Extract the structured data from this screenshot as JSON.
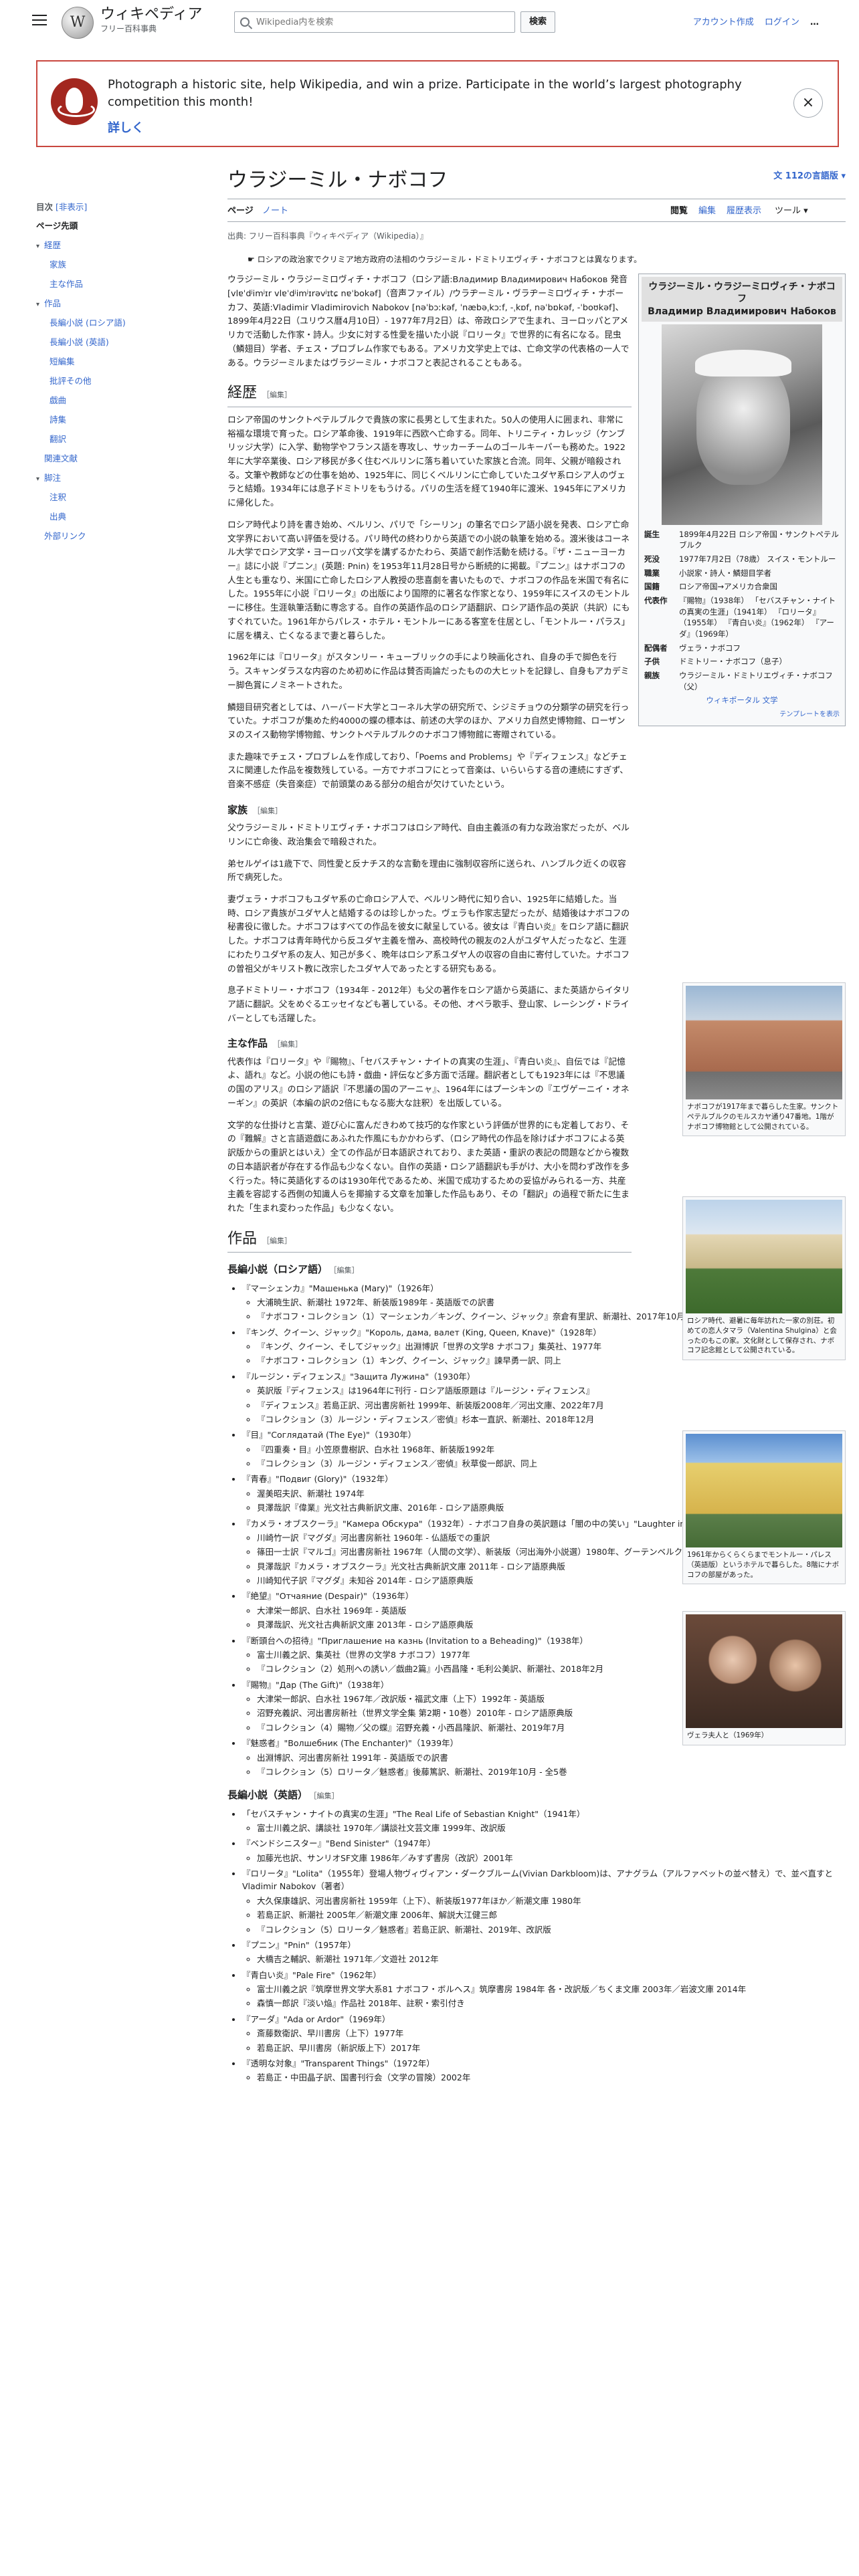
{
  "header": {
    "logo_title": "ウィキペディア",
    "logo_subtitle": "フリー百科事典",
    "search_placeholder": "Wikipedia内を検索",
    "search_button": "検索",
    "account_create": "アカウント作成",
    "login": "ログイン",
    "more": "…"
  },
  "banner": {
    "text": "Photograph a historic site, help Wikipedia, and win a prize. Participate in the world’s largest photography competition this month!",
    "more_label": "詳しく",
    "close": "×"
  },
  "toc": {
    "title": "目次",
    "hide": "[非表示]",
    "items": [
      {
        "label": "ページ先頭",
        "level": 0
      },
      {
        "label": "経歴",
        "level": 1,
        "expand": true
      },
      {
        "label": "家族",
        "level": 2
      },
      {
        "label": "主な作品",
        "level": 2
      },
      {
        "label": "作品",
        "level": 1,
        "expand": true
      },
      {
        "label": "長編小説 (ロシア語)",
        "level": 2
      },
      {
        "label": "長編小説 (英語)",
        "level": 2
      },
      {
        "label": "短編集",
        "level": 2
      },
      {
        "label": "批評その他",
        "level": 2
      },
      {
        "label": "戯曲",
        "level": 2
      },
      {
        "label": "詩集",
        "level": 2
      },
      {
        "label": "翻訳",
        "level": 2
      },
      {
        "label": "関連文献",
        "level": 1
      },
      {
        "label": "脚注",
        "level": 1,
        "expand": true
      },
      {
        "label": "注釈",
        "level": 2
      },
      {
        "label": "出典",
        "level": 2
      },
      {
        "label": "外部リンク",
        "level": 1
      }
    ]
  },
  "article": {
    "title": "ウラジーミル・ナボコフ",
    "languages": "112の言語版",
    "tab_page": "ページ",
    "tab_talk": "ノート",
    "tab_read": "閲覧",
    "tab_edit": "編集",
    "tab_history": "履歴表示",
    "tab_tools": "ツール",
    "tagline": "出典: フリー百科事典『ウィキペディア（Wikipedia）』",
    "hatnote": "ロシアの政治家でクリミア地方政府の法相のウラジーミル・ドミトリエヴィチ・ナボコフとは異なります。",
    "lead": "ウラジーミル・ウラジーミロヴィチ・ナボコフ（ロシア語:Владимир Владимирович Набоков 発音 [vlɐˈdʲimʲɪr vlɐˈdʲimʲɪrəvʲɪtɕ nɐˈbokəf]（音声ファイル）/ウラヂーミル・ヴラヂーミロヴィチ・ナボーカフ、英語:Vladimir Vladimirovich Nabokov [nəˈbɔːkəf, ˈnæbəˌkɔːf, -ˌkɒf, nəˈbɒkəf, -ˈboʊkəf]、1899年4月22日（ユリウス暦4月10日）- 1977年7月2日）は、帝政ロシアで生まれ、ヨーロッパとアメリカで活動した作家・詩人。少女に対する性愛を描いた小説『ロリータ』で世界的に有名になる。昆虫（鱗翅目）学者、チェス・プロブレム作家でもある。アメリカ文学史上では、亡命文学の代表格の一人である。ウラジーミルまたはヴラジーミル・ナボコフと表記されることもある。",
    "sections": {
      "career": "経歴",
      "family": "家族",
      "main_works": "主な作品",
      "works": "作品",
      "novels_ru": "長編小説（ロシア語）",
      "novels_en": "長編小説（英語）",
      "edit": "［編集］"
    },
    "career_p1": "ロシア帝国のサンクトペテルブルクで貴族の家に長男として生まれた。50人の使用人に囲まれ、非常に裕福な環境で育った。ロシア革命後、1919年に西欧へ亡命する。同年、トリニティ・カレッジ（ケンブリッジ大学）に入学、動物学やフランス語を専攻し、サッカーチームのゴールキーパーも務めた。1922年に大学卒業後、ロシア移民が多く住むベルリンに落ち着いていた家族と合流。同年、父親が暗殺される。文筆や教師などの仕事を始め、1925年に、同じくベルリンに亡命していたユダヤ系ロシア人のヴェラと結婚。1934年には息子ドミトリをもうける。パリの生活を経て1940年に渡米、1945年にアメリカに帰化した。",
    "career_p2": "ロシア時代より詩を書き始め、ベルリン、パリで「シーリン」の筆名でロシア語小説を発表、ロシア亡命文学界において高い評価を受ける。パリ時代の終わりから英語での小説の執筆を始める。渡米後はコーネル大学でロシア文学・ヨーロッパ文学を講ずるかたわら、英語で創作活動を続ける。『ザ・ニューヨーカー』誌に小説『プニン』(英題: Pnin) を1953年11月28日号から断続的に掲載。『プニン』はナボコフの人生とも重なり、米国に亡命したロシア人教授の悲喜劇を書いたもので、ナボコフの作品を米国で有名にした。1955年に小説『ロリータ』の出版により国際的に著名な作家となり、1959年にスイスのモントルーに移住。生涯執筆活動に専念する。自作の英語作品のロシア語翻訳、ロシア語作品の英訳（共訳）にもすぐれていた。1961年からパレス・ホテル・モントルーにある客室を住居とし、「モントルー・パラス」に居を構え、亡くなるまで妻と暮らした。",
    "career_p3": "1962年には『ロリータ』がスタンリー・キューブリックの手により映画化され、自身の手で脚色を行う。スキャンダラスな内容のため初めに作品は賛否両論だったものの大ヒットを記録し、自身もアカデミー脚色賞にノミネートされた。",
    "career_p4": "鱗翅目研究者としては、ハーバード大学とコーネル大学の研究所で、シジミチョウの分類学の研究を行っていた。ナボコフが集めた約4000の蝶の標本は、前述の大学のほか、アメリカ自然史博物館、ローザンヌのスイス動物学博物館、サンクトペテルブルクのナボコフ博物館に寄贈されている。",
    "career_p5": "また趣味でチェス・プロブレムを作成しており、「Poems and Problems」や『ディフェンス』などチェスに関連した作品を複数残している。一方でナボコフにとって音楽は、いらいらする音の連続にすぎず、音楽不感症（失音楽症）で前頭葉のある部分の組合が欠けていたという。",
    "family_p1": "父ウラジーミル・ドミトリエヴィチ・ナボコフはロシア時代、自由主義派の有力な政治家だったが、ベルリンに亡命後、政治集会で暗殺された。",
    "family_p2": "弟セルゲイは1歳下で、同性愛と反ナチス的な言動を理由に強制収容所に送られ、ハンブルク近くの収容所で病死した。",
    "family_p3": "妻ヴェラ・ナボコフもユダヤ系の亡命ロシア人で、ベルリン時代に知り合い、1925年に結婚した。当時、ロシア貴族がユダヤ人と結婚するのは珍しかった。ヴェラも作家志望だったが、結婚後はナボコフの秘書役に徹した。ナボコフはすべての作品を彼女に献呈している。彼女は『青白い炎』をロシア語に翻訳した。ナボコフは青年時代から反ユダヤ主義を憎み、高校時代の親友の2人がユダヤ人だったなど、生涯にわたりユダヤ系の友人、知己が多く、晩年はロシア系ユダヤ人の収容の自由に寄付していた。ナボコフの曽祖父がキリスト教に改宗したユダヤ人であったとする研究もある。",
    "family_p4": "息子ドミトリー・ナボコフ（1934年 - 2012年）も父の著作をロシア語から英語に、また英語からイタリア語に翻訳。父をめぐるエッセイなども著している。その他、オペラ歌手、登山家、レーシング・ドライバーとしても活躍した。",
    "main_p1": "代表作は『ロリータ』や『賜物』、「セバスチャン・ナイトの真実の生涯」、『青白い炎』、自伝では『記憶よ、語れ』など。小説の他にも詩・戯曲・評伝など多方面で活躍。翻訳者としても1923年には『不思議の国のアリス』のロシア語訳『不思議の国のアーニャ』、1964年にはプーシキンの『エヴゲーニイ・オネーギン』の英訳（本編の訳の2倍にもなる膨大な註釈）を出版している。",
    "main_p2": "文学的な仕掛けと言葉、遊び心に富んだきわめて技巧的な作家という評価が世界的にも定着しており、その『難解』さと言語遊戯にあふれた作風にもかかわらず、（ロシア時代の作品を除けばナボコフによる英訳版からの重訳とはいえ）全ての作品が日本語訳されており、また英語・重訳の表記の問題などから複数の日本語訳者が存在する作品も少なくない。自作の英語・ロシア語翻訳も手がけ、大小を問わず改作を多く行った。特に英語化するのは1930年代であるため、米国で成功するための妥協がみられる一方、共産主義を容認する西側の知識人らを揶揄する文章を加筆した作品もあり、その「翻訳」の過程で新たに生まれた「生まれ変わった作品」も少なくない。",
    "infobox": {
      "title": "ウラジーミル・ウラジーミロヴィチ・ナボコフ",
      "title_ru": "Владимир Владимирович Набоков",
      "rows": [
        {
          "k": "誕生",
          "v": "1899年4月22日 ロシア帝国・サンクトペテルブルク"
        },
        {
          "k": "死没",
          "v": "1977年7月2日（78歳） スイス・モントルー"
        },
        {
          "k": "職業",
          "v": "小説家・詩人・鱗翅目学者"
        },
        {
          "k": "国籍",
          "v": "ロシア帝国→アメリカ合衆国"
        },
        {
          "k": "代表作",
          "v": "『賜物』（1938年） 「セバスチャン・ナイトの真実の生涯」（1941年） 『ロリータ』（1955年） 『青白い炎』（1962年） 『アーダ』（1969年）"
        },
        {
          "k": "配偶者",
          "v": "ヴェラ・ナボコフ"
        },
        {
          "k": "子供",
          "v": "ドミトリー・ナボコフ（息子）"
        },
        {
          "k": "親族",
          "v": "ウラジーミル・ドミトリエヴィチ・ナボコフ（父）"
        }
      ],
      "wikiquote": "ウィキポータル 文学",
      "template": "テンプレートを表示"
    },
    "figures": [
      {
        "caption": "ナボコフが1917年まで暮らした生家。サンクトペテルブルクのモルスカヤ通り47番地。1階がナボコフ博物館として公開されている。"
      },
      {
        "caption": "ロシア時代、避暑に毎年訪れた一家の別荘。初めての恋人タマラ（Valentina Shulgina）と会ったのもこの家。文化財として保存され、ナボコフ記念館として公開されている。"
      },
      {
        "caption": "1961年からくらくらまでモントルー・パレス（英語版）というホテルで暮らした。8階にナボコフの部屋があった。"
      },
      {
        "caption": "ヴェラ夫人と（1969年）"
      }
    ],
    "works_ru": [
      {
        "t": "『マーシェンカ』\"Машенька (Mary)\"（1926年）",
        "sub": [
          "大浦暁生訳、新潮社 1972年、新装版1989年 - 英語版での訳書",
          "『ナボコフ・コレクション（1）マーシェンカ／キング、クイーン、ジャック』奈倉有里訳、新潮社、2017年10月 - ロシア語原典版での訳書"
        ]
      },
      {
        "t": "『キング、クイーン、ジャック』\"Король, дама, валет (King, Queen, Knave)\"（1928年）",
        "sub": [
          "『キング、クイーン、そしてジャック』出淵博訳「世界の文学8 ナボコフ」集英社、1977年",
          "『ナボコフ・コレクション（1）キング、クイーン、ジャック』諫早勇一訳、同上"
        ]
      },
      {
        "t": "『ルージン・ディフェンス』\"Защита Лужина\"（1930年）",
        "sub": [
          "英訳版『ディフェンス』は1964年に刊行 - ロシア語版原題は『ルージン・ディフェンス』",
          "『ディフェンス』若島正訳、河出書房新社 1999年、新装版2008年／河出文庫、2022年7月",
          "『コレクション（3）ルージン・ディフェンス／密偵』杉本一直訳、新潮社、2018年12月"
        ]
      },
      {
        "t": "『目』\"Соглядатай (The Eye)\"（1930年）",
        "sub": [
          "『四重奏・目』小笠原豊樹訳、白水社 1968年、新装版1992年",
          "『コレクション（3）ルージン・ディフェンス／密偵』秋草俊一郎訳、同上"
        ]
      },
      {
        "t": "『青春』\"Подвиг (Glory)\"（1932年）",
        "sub": [
          "渥美昭夫訳、新潮社 1974年",
          "貝澤哉訳『偉業』光文社古典新訳文庫、2016年 - ロシア語原典版"
        ]
      },
      {
        "t": "『カメラ・オブスクーラ』\"Камера Обскура\"（1932年）- ナボコフ自身の英訳題は「闇の中の笑い」\"Laughter in the Dark\"",
        "sub": [
          "川崎竹一訳『マグダ』河出書房新社 1960年 - 仏語版での重訳",
          "篠田一士訳『マルゴ』河出書房新社 1967年（人間の文学）、新装版（河出海外小説選）1980年、グーテンベルク21（電子出版）、2022年 - 英語版での訳書",
          "貝澤哉訳『カメラ・オブスクーラ』光文社古典新訳文庫 2011年 - ロシア語原典版",
          "川崎知代子訳『マグダ』未知谷 2014年 - ロシア語原典版"
        ]
      },
      {
        "t": "『絶望』\"Отчаяние (Despair)\"（1936年）",
        "sub": [
          "大津栄一郎訳、白水社 1969年 - 英語版",
          "貝澤哉訳、光文社古典新訳文庫 2013年 - ロシア語原典版"
        ]
      },
      {
        "t": "『断頭台への招待』\"Приглашение на казнь (Invitation to a Beheading)\"（1938年）",
        "sub": [
          "富士川義之訳、集英社（世界の文学8 ナボコフ）1977年",
          "『コレクション（2）処刑への誘い／戯曲2篇』小西昌隆・毛利公美訳、新潮社、2018年2月"
        ]
      },
      {
        "t": "『賜物』\"Дар (The Gift)\"（1938年）",
        "sub": [
          "大津栄一郎訳、白水社 1967年／改訳版・福武文庫（上下）1992年 - 英語版",
          "沼野充義訳、河出書房新社（世界文学全集 第2期・10巻）2010年 - ロシア語原典版",
          "『コレクション（4）賜物／父の蝶』沼野充義・小西昌隆訳、新潮社、2019年7月"
        ]
      },
      {
        "t": "『魅惑者』\"Волшебник (The Enchanter)\"（1939年）",
        "sub": [
          "出淵博訳、河出書房新社 1991年 - 英語版での訳書",
          "『コレクション（5）ロリータ／魅惑者』後藤篤訳、新潮社、2019年10月 - 全5巻"
        ]
      }
    ],
    "works_en": [
      {
        "t": "「セバスチャン・ナイトの真実の生涯」\"The Real Life of Sebastian Knight\"（1941年）",
        "sub": [
          "富士川義之訳、講談社 1970年／講談社文芸文庫 1999年、改訳版"
        ]
      },
      {
        "t": "『ベンドシニスター』\"Bend Sinister\"（1947年）",
        "sub": [
          "加藤光也訳、サンリオSF文庫 1986年／みすず書房（改訳）2001年"
        ]
      },
      {
        "t": "『ロリータ』\"Lolita\"（1955年）登場人物ヴィヴィアン・ダークブルーム(Vivian Darkbloom)は、アナグラム（アルファベットの並べ替え）で、並べ直すとVladimir Nabokov（著者）",
        "sub": [
          "大久保康雄訳、河出書房新社 1959年（上下）、新装版1977年ほか／新潮文庫 1980年",
          "若島正訳、新潮社 2005年／新潮文庫 2006年、解説大江健三郎",
          "『コレクション（5）ロリータ／魅惑者』若島正訳、新潮社、2019年、改訳版"
        ]
      },
      {
        "t": "『プニン』\"Pnin\"（1957年）",
        "sub": [
          "大橋吉之輔訳、新潮社 1971年／文遊社 2012年"
        ]
      },
      {
        "t": "『青白い炎』\"Pale Fire\"（1962年）",
        "sub": [
          "富士川義之訳『筑摩世界文学大系81 ナボコフ・ボルヘス』筑摩書房 1984年 各・改訳版／ちくま文庫 2003年／岩波文庫 2014年",
          "森慎一郎訳『淡い焔』作品社 2018年、註釈・索引付き"
        ]
      },
      {
        "t": "『アーダ』\"Ada or Ardor\"（1969年）",
        "sub": [
          "斎藤数衛訳、早川書房（上下）1977年",
          "若島正訳、早川書房（新訳版上下）2017年"
        ]
      },
      {
        "t": "『透明な対象』\"Transparent Things\"（1972年）",
        "sub": [
          "若島正・中田晶子訳、国書刊行会（文学の冒険）2002年"
        ]
      }
    ]
  }
}
